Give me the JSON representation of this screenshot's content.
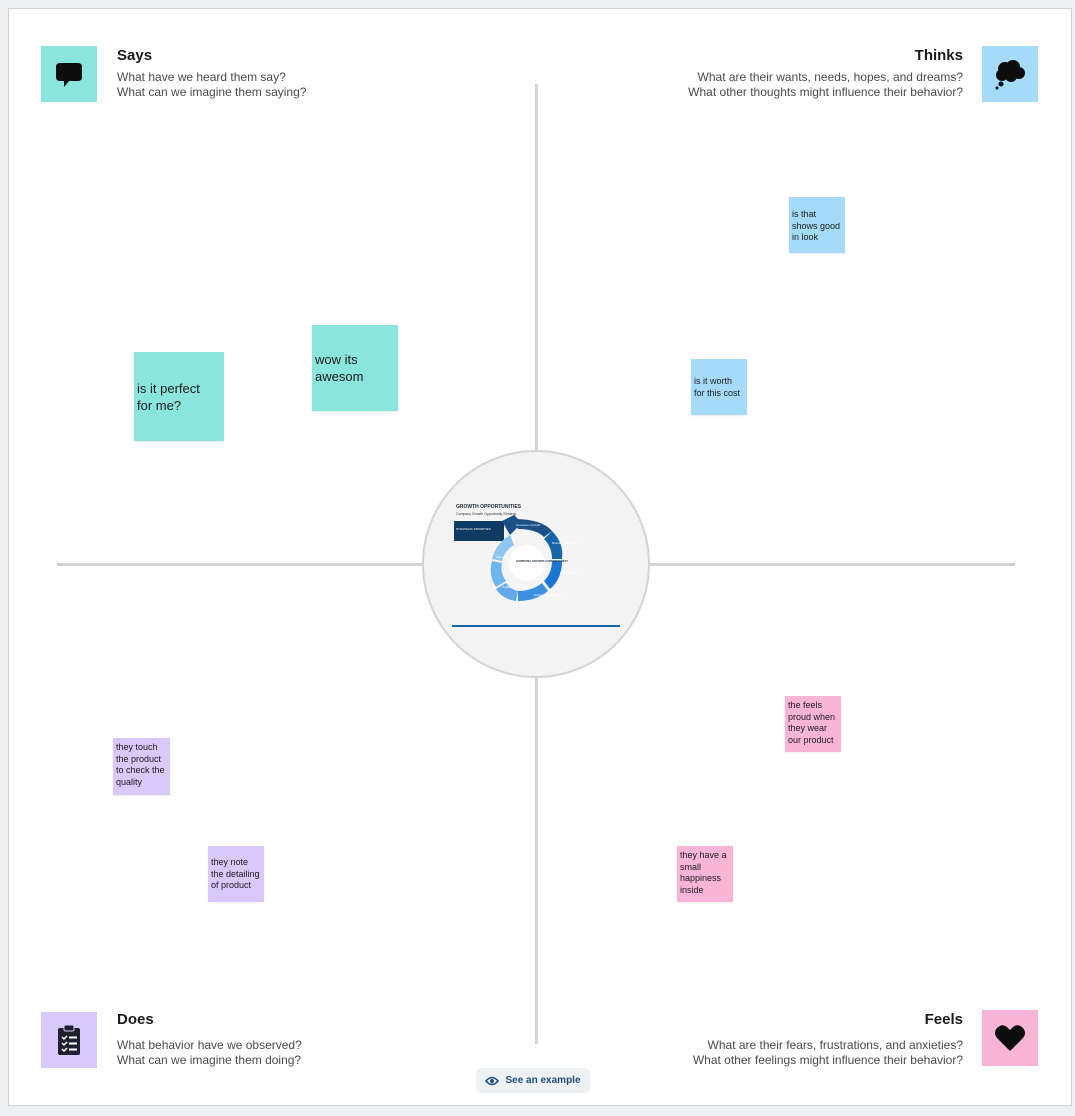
{
  "quadrants": {
    "says": {
      "title": "Says",
      "line1": "What have we heard them say?",
      "line2": "What can we imagine them saying?",
      "icon": "speech-bubble-icon",
      "color": "#8ae6dc"
    },
    "thinks": {
      "title": "Thinks",
      "line1": "What are their wants, needs, hopes, and dreams?",
      "line2": "What other thoughts might influence their behavior?",
      "icon": "thought-cloud-icon",
      "color": "#a5dbf8"
    },
    "does": {
      "title": "Does",
      "line1": "What behavior have we observed?",
      "line2": "What can we imagine them doing?",
      "icon": "clipboard-checklist-icon",
      "color": "#d9c8fb"
    },
    "feels": {
      "title": "Feels",
      "line1": "What are their fears, frustrations, and anxieties?",
      "line2": "What other feelings might influence their behavior?",
      "icon": "heart-icon",
      "color": "#f9b5d7"
    }
  },
  "stickies": {
    "says_1": [
      "is it perfect",
      "for me?"
    ],
    "says_2": [
      "wow its",
      "awesom"
    ],
    "thinks_1": [
      "is that",
      "shows good",
      "in look"
    ],
    "thinks_2": [
      "is it worth",
      "for this cost"
    ],
    "does_1": [
      "they touch",
      "the product",
      "to check the",
      "quality"
    ],
    "does_2": [
      "they note",
      "the detailing",
      "of product"
    ],
    "feels_1": [
      "the feels",
      "proud when",
      "they wear",
      "our product"
    ],
    "feels_2": [
      "they have a",
      "small",
      "happiness",
      "inside"
    ]
  },
  "center_image": {
    "title": "GROWTH OPPORTUNITIES",
    "subtitle": "Company Growth Opportunity Strategy",
    "labels": {
      "strategic": "STRATEGIC PRIORITIES",
      "center": "COMPANY GROWTH OPPORTUNITY",
      "l1": "Consumer Growth",
      "l2": "Business Alignment",
      "l3": "Market Share",
      "l4": "Digital Transformation",
      "l5": "Strategic Partnerships",
      "l6": "Innovation"
    }
  },
  "see_example": {
    "label": "See an example",
    "icon": "eye-icon"
  }
}
